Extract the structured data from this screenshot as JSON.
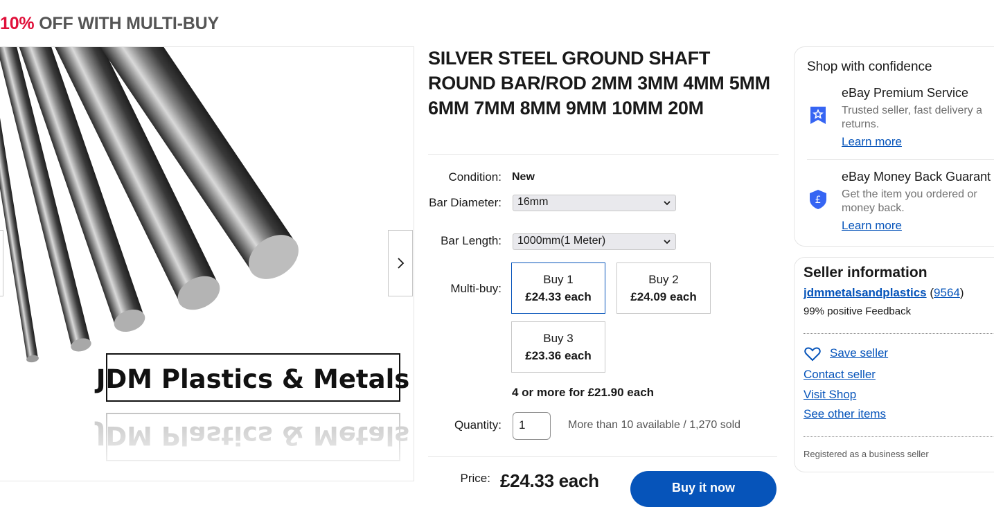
{
  "promo": {
    "percent": "10%",
    "text": "OFF WITH MULTI-BUY"
  },
  "listing": {
    "title": "SILVER STEEL GROUND SHAFT ROUND BAR/ROD 2MM 3MM 4MM 5MM 6MM 7MM 8MM 9MM 10MM 20M",
    "image_caption": "JDM Plastics & Metals",
    "condition_label": "Condition:",
    "condition_value": "New",
    "bar_diameter_label": "Bar Diameter:",
    "bar_diameter_value": "16mm",
    "bar_length_label": "Bar Length:",
    "bar_length_value": "1000mm(1 Meter)",
    "multibuy_label": "Multi-buy:",
    "multibuy": [
      {
        "qty": "Buy 1",
        "price": "£24.33 each",
        "selected": true
      },
      {
        "qty": "Buy 2",
        "price": "£24.09 each",
        "selected": false
      },
      {
        "qty": "Buy 3",
        "price": "£23.36 each",
        "selected": false
      }
    ],
    "multibuy_more": "4 or more for £21.90 each",
    "quantity_label": "Quantity:",
    "quantity_value": "1",
    "availability": "More than 10 available / 1,270 sold",
    "price_label": "Price:",
    "price_value": "£24.33 each",
    "buy_button": "Buy it now"
  },
  "confidence": {
    "title": "Shop with confidence",
    "premium_title": "eBay Premium Service",
    "premium_text_1": "Trusted seller, fast delivery a",
    "premium_text_2": "returns.",
    "premium_link": "Learn more",
    "mbg_title": "eBay Money Back Guarant",
    "mbg_text_1": "Get the item you ordered or",
    "mbg_text_2": "money back.",
    "mbg_link": "Learn more"
  },
  "seller": {
    "title": "Seller information",
    "name": "jdmmetalsandplastics",
    "score": "9564",
    "feedback": "99% positive Feedback",
    "save_seller": "Save seller",
    "contact_seller": "Contact seller",
    "visit_shop": "Visit Shop",
    "other_items": "See other items",
    "registered": "Registered as a business seller"
  },
  "colors": {
    "accent": "#0654ba",
    "promo_red": "#e0103a"
  }
}
